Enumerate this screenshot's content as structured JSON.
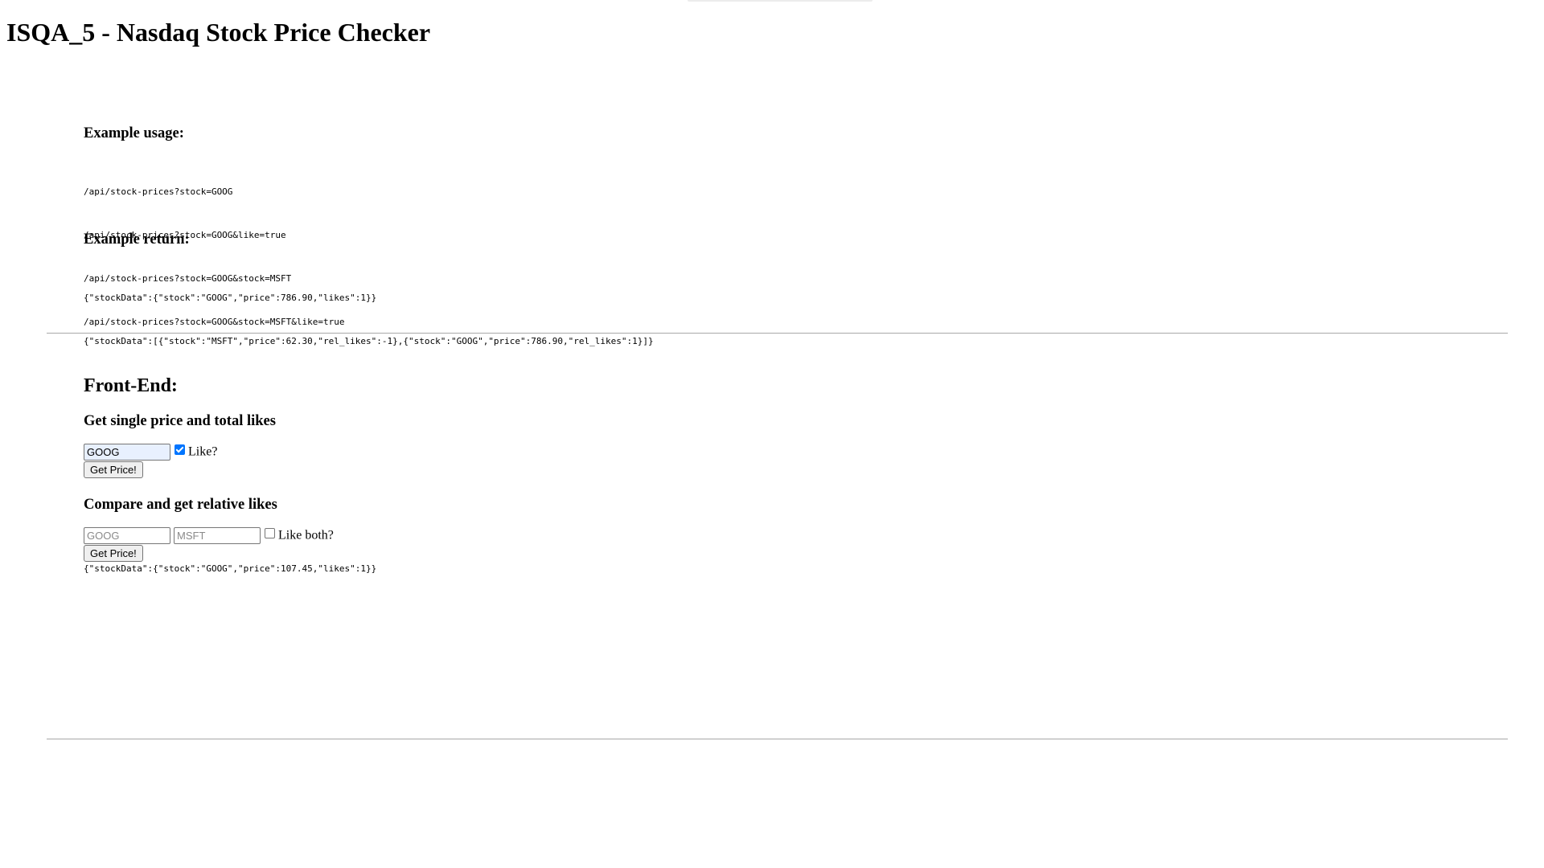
{
  "header": {
    "title": "ISQA_5 - Nasdaq Stock Price Checker"
  },
  "usage": {
    "heading": "Example usage:",
    "lines": [
      "/api/stock-prices?stock=GOOG",
      "/api/stock-prices?stock=GOOG&like=true",
      "/api/stock-prices?stock=GOOG&stock=MSFT",
      "/api/stock-prices?stock=GOOG&stock=MSFT&like=true"
    ]
  },
  "return": {
    "heading": "Example return:",
    "lines": [
      "{\"stockData\":{\"stock\":\"GOOG\",\"price\":786.90,\"likes\":1}}",
      "{\"stockData\":[{\"stock\":\"MSFT\",\"price\":62.30,\"rel_likes\":-1},{\"stock\":\"GOOG\",\"price\":786.90,\"rel_likes\":1}]}"
    ]
  },
  "frontend": {
    "heading": "Front-End:",
    "single": {
      "heading": "Get single price and total likes",
      "stock_value": "GOOG",
      "like_label": "Like?",
      "like_checked": true,
      "button_label": "Get Price!"
    },
    "compare": {
      "heading": "Compare and get relative likes",
      "stock1_placeholder": "GOOG",
      "stock2_placeholder": "MSFT",
      "like_label": "Like both?",
      "like_checked": false,
      "button_label": "Get Price!"
    },
    "result": "{\"stockData\":{\"stock\":\"GOOG\",\"price\":107.45,\"likes\":1}}"
  },
  "colors": {
    "checkbox_accent": "#0075ff",
    "autofill_background": "#e8f0fe",
    "divider": "#a8a8a8"
  }
}
